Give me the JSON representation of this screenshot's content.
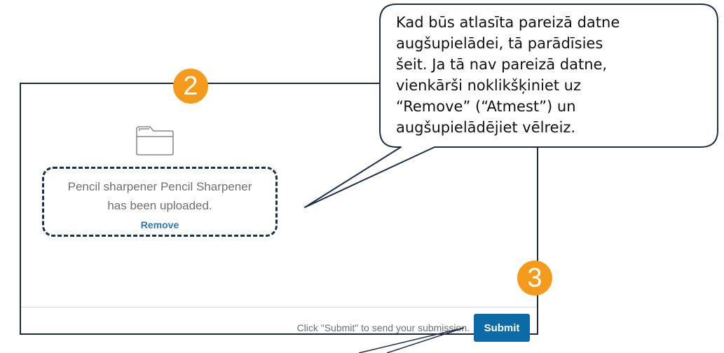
{
  "upload": {
    "status_line_1": "Pencil sharpener Pencil Sharpener",
    "status_line_2": "has been uploaded.",
    "remove_label": "Remove"
  },
  "footer": {
    "hint": "Click \"Submit\" to send your submission.",
    "submit_label": "Submit"
  },
  "annotations": {
    "step_2": "2",
    "step_3": "3",
    "callout_lines": [
      "Kad būs atlasīta pareizā datne",
      "augšupielādei, tā parādīsies",
      "šeit. Ja tā nav pareizā datne,",
      "vienkārši noklikšķiniet uz",
      "“Remove” (“Atmest”) un",
      "augšupielādējiet vēlreiz."
    ],
    "badge_color": "#f49a1c",
    "callout_border_color": "#1f2f44"
  },
  "icons": {
    "folder": "folder-icon"
  }
}
